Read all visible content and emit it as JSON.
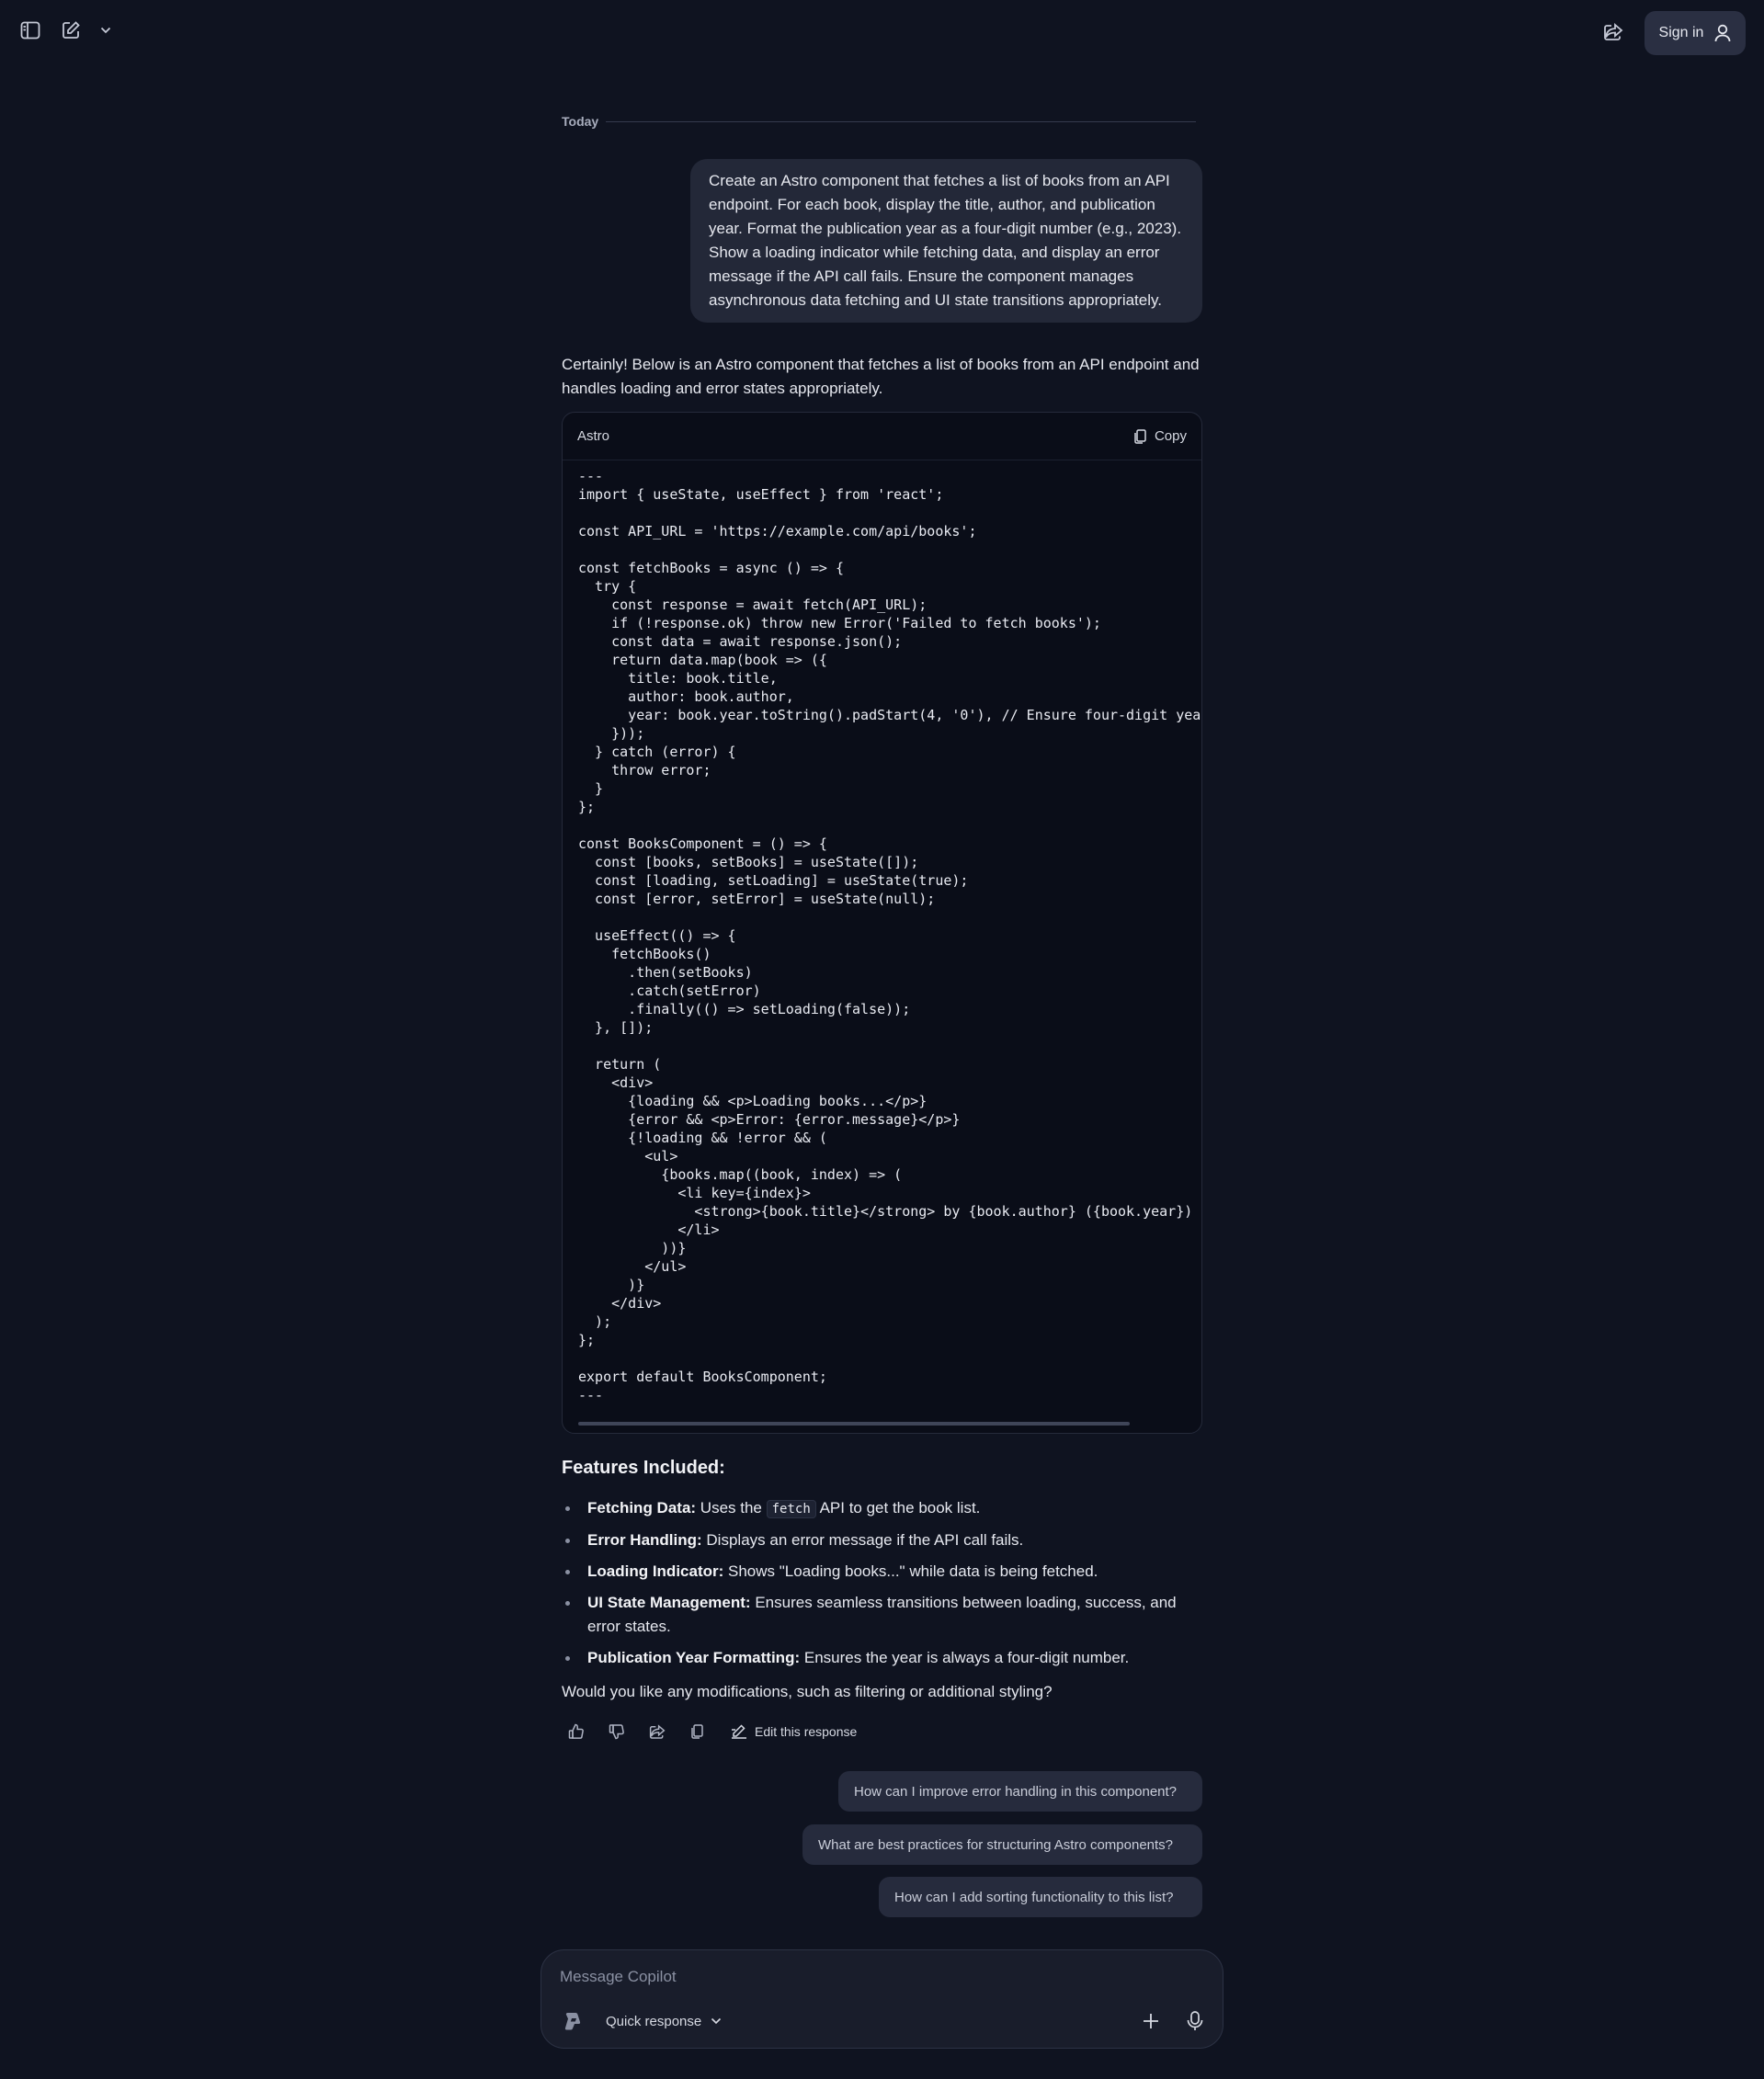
{
  "topbar": {
    "signin_label": "Sign in"
  },
  "divider": {
    "label": "Today"
  },
  "user_message": "Create an Astro component that fetches a list of books from an API endpoint. For each book, display the title, author, and publication year. Format the publication year as a four-digit number (e.g., 2023). Show a loading indicator while fetching data, and display an error message if the API call fails. Ensure the component manages asynchronous data fetching and UI state transitions appropriately.",
  "assistant": {
    "intro": "Certainly! Below is an Astro component that fetches a list of books from an API endpoint and handles loading and error states appropriately.",
    "code_language": "Astro",
    "copy_label": "Copy",
    "code": "---\nimport { useState, useEffect } from 'react';\n\nconst API_URL = 'https://example.com/api/books';\n\nconst fetchBooks = async () => {\n  try {\n    const response = await fetch(API_URL);\n    if (!response.ok) throw new Error('Failed to fetch books');\n    const data = await response.json();\n    return data.map(book => ({\n      title: book.title,\n      author: book.author,\n      year: book.year.toString().padStart(4, '0'), // Ensure four-digit year\n    }));\n  } catch (error) {\n    throw error;\n  }\n};\n\nconst BooksComponent = () => {\n  const [books, setBooks] = useState([]);\n  const [loading, setLoading] = useState(true);\n  const [error, setError] = useState(null);\n\n  useEffect(() => {\n    fetchBooks()\n      .then(setBooks)\n      .catch(setError)\n      .finally(() => setLoading(false));\n  }, []);\n\n  return (\n    <div>\n      {loading && <p>Loading books...</p>}\n      {error && <p>Error: {error.message}</p>}\n      {!loading && !error && (\n        <ul>\n          {books.map((book, index) => (\n            <li key={index}>\n              <strong>{book.title}</strong> by {book.author} ({book.year})\n            </li>\n          ))}\n        </ul>\n      )}\n    </div>\n  );\n};\n\nexport default BooksComponent;\n---",
    "features_title": "Features Included:",
    "features": [
      {
        "label": "Fetching Data:",
        "pre": "Uses the",
        "code": "fetch",
        "post": "API to get the book list."
      },
      {
        "label": "Error Handling:",
        "text": "Displays an error message if the API call fails."
      },
      {
        "label": "Loading Indicator:",
        "text": "Shows \"Loading books...\" while data is being fetched."
      },
      {
        "label": "UI State Management:",
        "text": "Ensures seamless transitions between loading, success, and error states."
      },
      {
        "label": "Publication Year Formatting:",
        "text": "Ensures the year is always a four-digit number."
      }
    ],
    "question": "Would you like any modifications, such as filtering or additional styling?",
    "edit_label": "Edit this response"
  },
  "suggestions": [
    "How can I improve error handling in this component?",
    "What are best practices for structuring Astro components?",
    "How can I add sorting functionality to this list?"
  ],
  "composer": {
    "placeholder": "Message Copilot",
    "mode_label": "Quick response"
  },
  "icons": {
    "sidebar": "sidebar-toggle-icon",
    "new_chat": "compose-icon",
    "share": "share-icon",
    "user": "user-icon",
    "copy": "copy-icon",
    "thumbs_up": "thumbs-up-icon",
    "thumbs_down": "thumbs-down-icon",
    "plus": "plus-icon",
    "mic": "microphone-icon"
  }
}
